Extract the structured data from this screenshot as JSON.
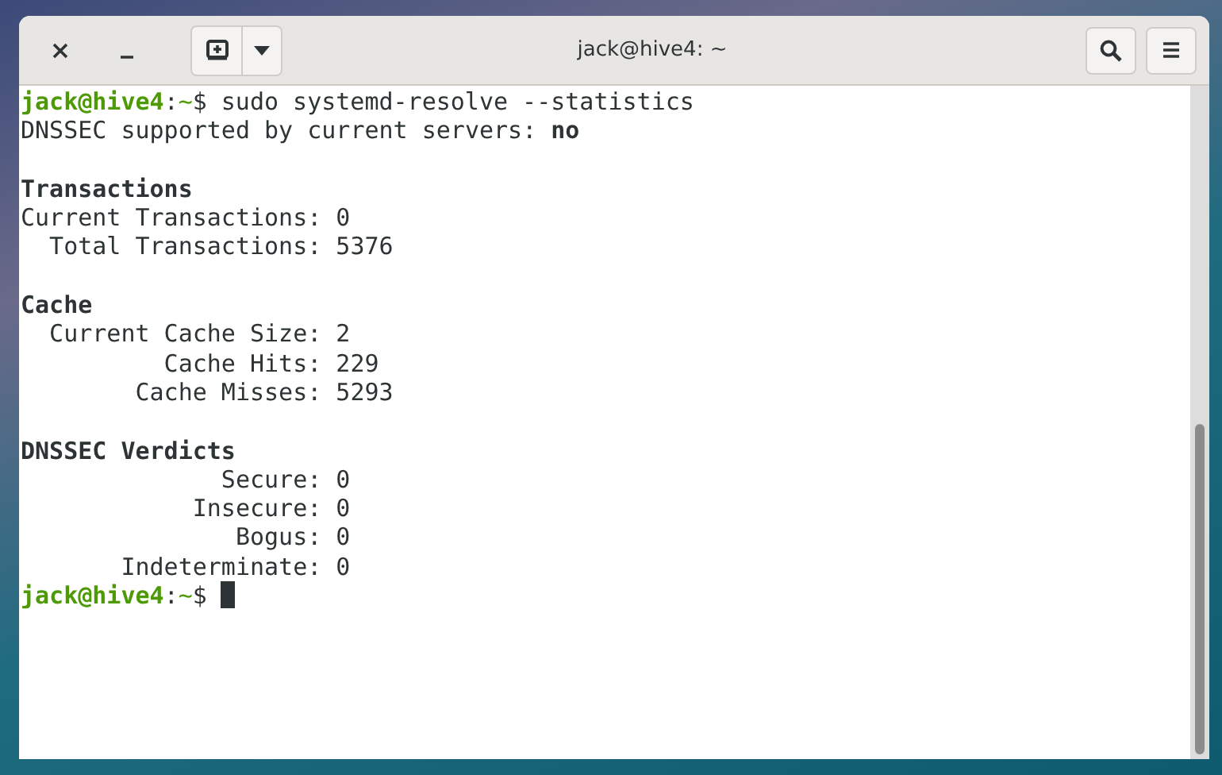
{
  "window": {
    "title": "jack@hive4: ~"
  },
  "lines": [
    {
      "kind": "prompt",
      "user": "jack@hive4",
      "separator": ":",
      "path": "~",
      "symbol": "$",
      "command": "sudo systemd-resolve --statistics"
    },
    {
      "kind": "output",
      "text": "DNSSEC supported by current servers: **no**"
    },
    {
      "kind": "blank"
    },
    {
      "kind": "heading",
      "text": "Transactions"
    },
    {
      "kind": "output",
      "text": "Current Transactions: 0"
    },
    {
      "kind": "output",
      "text": "  Total Transactions: 5376"
    },
    {
      "kind": "blank"
    },
    {
      "kind": "heading",
      "text": "Cache"
    },
    {
      "kind": "output",
      "text": "  Current Cache Size: 2"
    },
    {
      "kind": "output",
      "text": "          Cache Hits: 229"
    },
    {
      "kind": "output",
      "text": "        Cache Misses: 5293"
    },
    {
      "kind": "blank"
    },
    {
      "kind": "heading",
      "text": "DNSSEC Verdicts"
    },
    {
      "kind": "output",
      "text": "              Secure: 0"
    },
    {
      "kind": "output",
      "text": "            Insecure: 0"
    },
    {
      "kind": "output",
      "text": "               Bogus: 0"
    },
    {
      "kind": "output",
      "text": "       Indeterminate: 0"
    },
    {
      "kind": "prompt",
      "user": "jack@hive4",
      "separator": ":",
      "path": "~",
      "symbol": "$",
      "cursor": true
    }
  ]
}
